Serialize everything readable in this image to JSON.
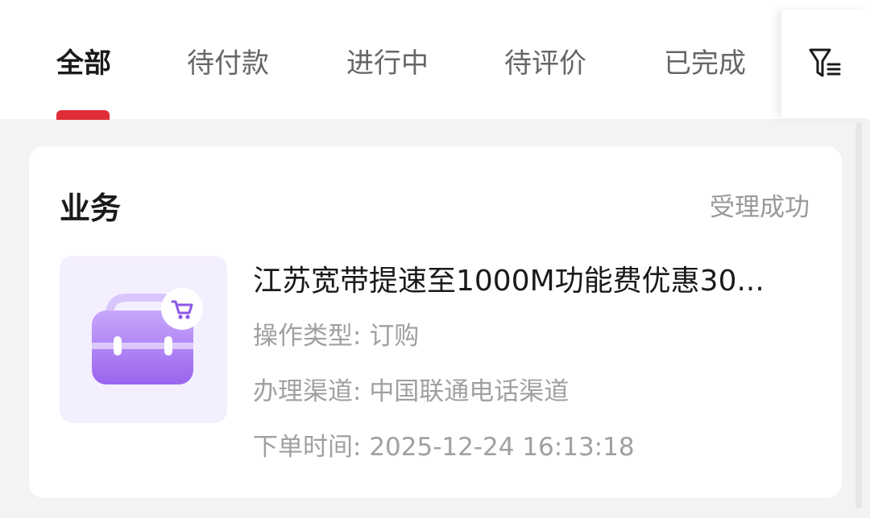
{
  "tabs": [
    {
      "label": "全部",
      "active": true
    },
    {
      "label": "待付款",
      "active": false
    },
    {
      "label": "进行中",
      "active": false
    },
    {
      "label": "待评价",
      "active": false
    },
    {
      "label": "已完成",
      "active": false
    }
  ],
  "filter": {
    "icon": "filter-icon"
  },
  "order": {
    "title": "业务",
    "status": "受理成功",
    "thumb_icon": "briefcase-cart-icon",
    "product_name": "江苏宽带提速至1000M功能费优惠30...",
    "rows": [
      {
        "label": "操作类型:",
        "value": "订购"
      },
      {
        "label": "办理渠道:",
        "value": "中国联通电话渠道"
      },
      {
        "label": "下单时间:",
        "value": "2025-12-24 16:13:18"
      }
    ]
  },
  "colors": {
    "accent": "#e02e36",
    "active_tab_text": "#1a1a1a",
    "inactive_tab_text": "#666666",
    "muted_text": "#a0a0a0",
    "thumb_bg": "#f4efff",
    "thumb_icon": "#9c6cf0"
  }
}
